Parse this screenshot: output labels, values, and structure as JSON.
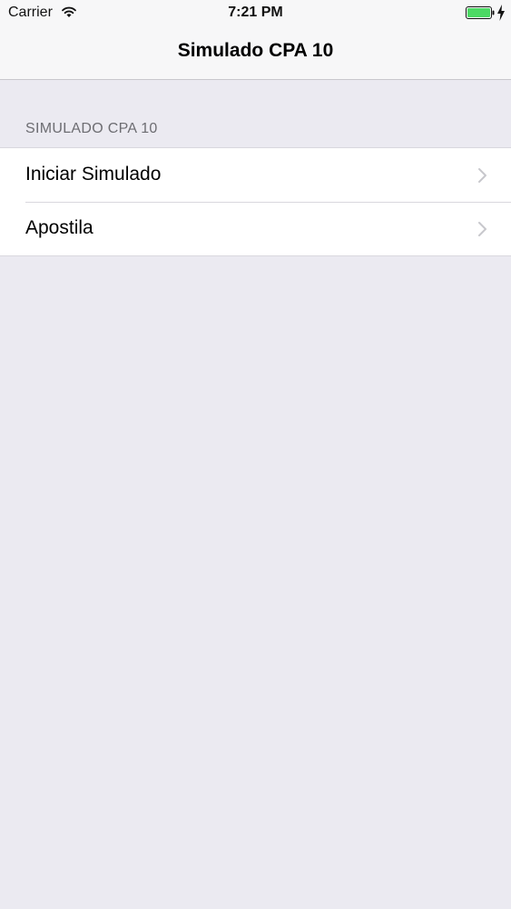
{
  "status_bar": {
    "carrier": "Carrier",
    "time": "7:21 PM",
    "battery_color": "#4cd964"
  },
  "nav": {
    "title": "Simulado CPA 10"
  },
  "section": {
    "header": "SIMULADO CPA 10",
    "items": [
      {
        "label": "Iniciar Simulado",
        "icon": "chevron-right-icon"
      },
      {
        "label": "Apostila",
        "icon": "chevron-right-icon"
      }
    ]
  }
}
